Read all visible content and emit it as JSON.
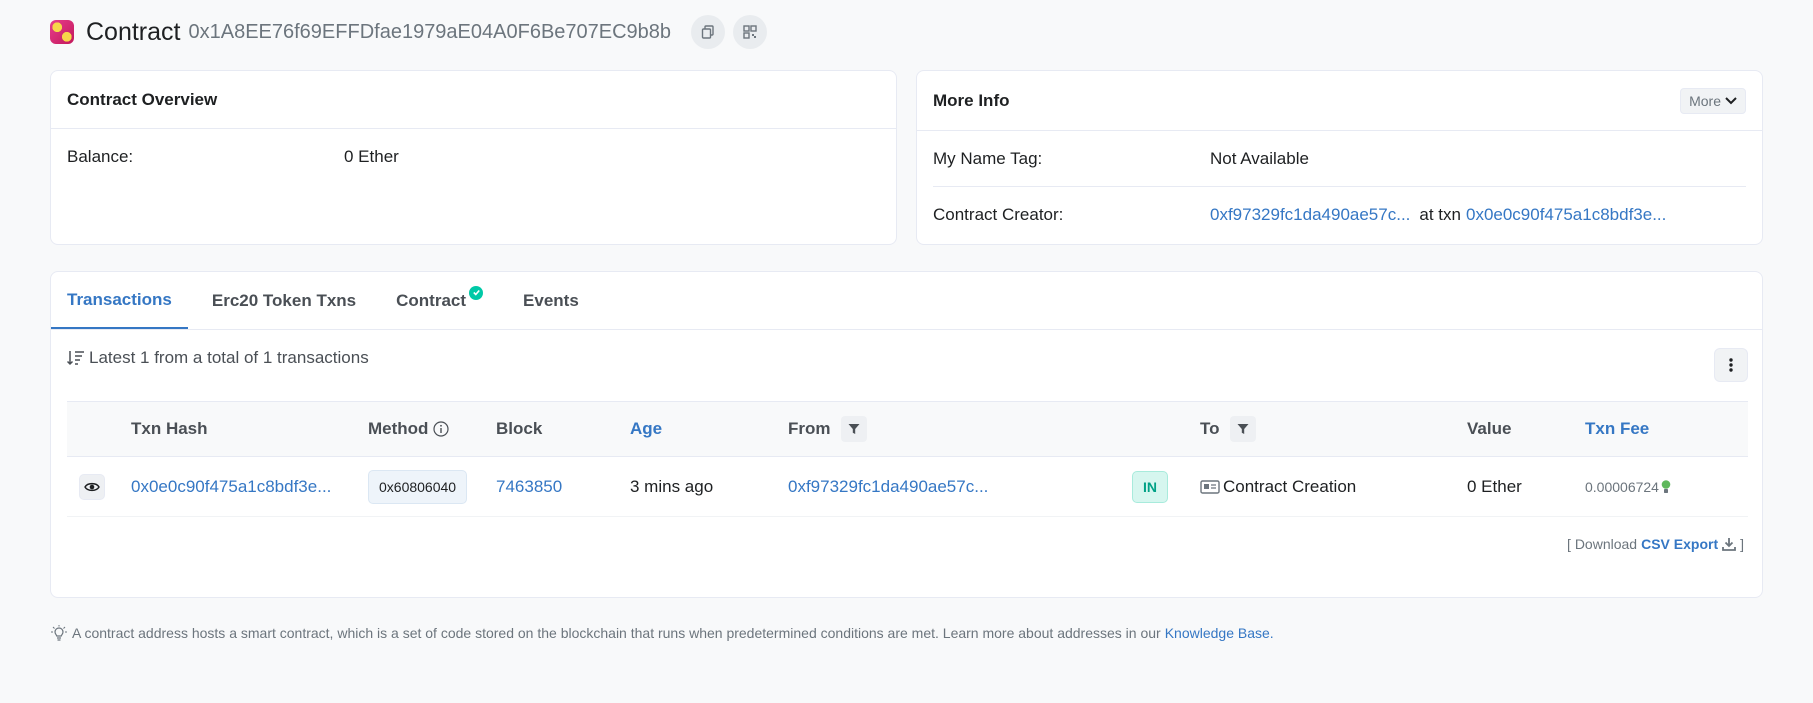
{
  "header": {
    "title": "Contract",
    "address": "0x1A8EE76f69EFFDfae1979aE04A0F6Be707EC9b8b"
  },
  "overview": {
    "title": "Contract Overview",
    "balance_label": "Balance:",
    "balance_value": "0 Ether"
  },
  "more_info": {
    "title": "More Info",
    "more_button": "More",
    "name_tag_label": "My Name Tag:",
    "name_tag_value": "Not Available",
    "creator_label": "Contract Creator:",
    "creator_address": "0xf97329fc1da490ae57c...",
    "at_txn": "at txn",
    "creator_txn": "0x0e0c90f475a1c8bdf3e..."
  },
  "tabs": [
    {
      "label": "Transactions",
      "active": true
    },
    {
      "label": "Erc20 Token Txns"
    },
    {
      "label": "Contract"
    },
    {
      "label": "Events"
    }
  ],
  "summary": "Latest 1 from a total of 1 transactions",
  "table": {
    "headers": {
      "hash": "Txn Hash",
      "method": "Method",
      "block": "Block",
      "age": "Age",
      "from": "From",
      "to": "To",
      "value": "Value",
      "fee": "Txn Fee"
    },
    "rows": [
      {
        "hash": "0x0e0c90f475a1c8bdf3e...",
        "method": "0x60806040",
        "block": "7463850",
        "age": "3 mins ago",
        "from": "0xf97329fc1da490ae57c...",
        "direction": "IN",
        "to": "Contract Creation",
        "value": "0 Ether",
        "fee": "0.00006724"
      }
    ]
  },
  "download": {
    "prefix": "[ Download",
    "csv": "CSV Export",
    "suffix": "]"
  },
  "footnote": {
    "text": "A contract address hosts a smart contract, which is a set of code stored on the blockchain that runs when predetermined conditions are met. Learn more about addresses in our",
    "link": "Knowledge Base."
  },
  "colors": {
    "accent": "#3577c4",
    "success": "#00c9a7",
    "in_badge": "#00a186"
  }
}
